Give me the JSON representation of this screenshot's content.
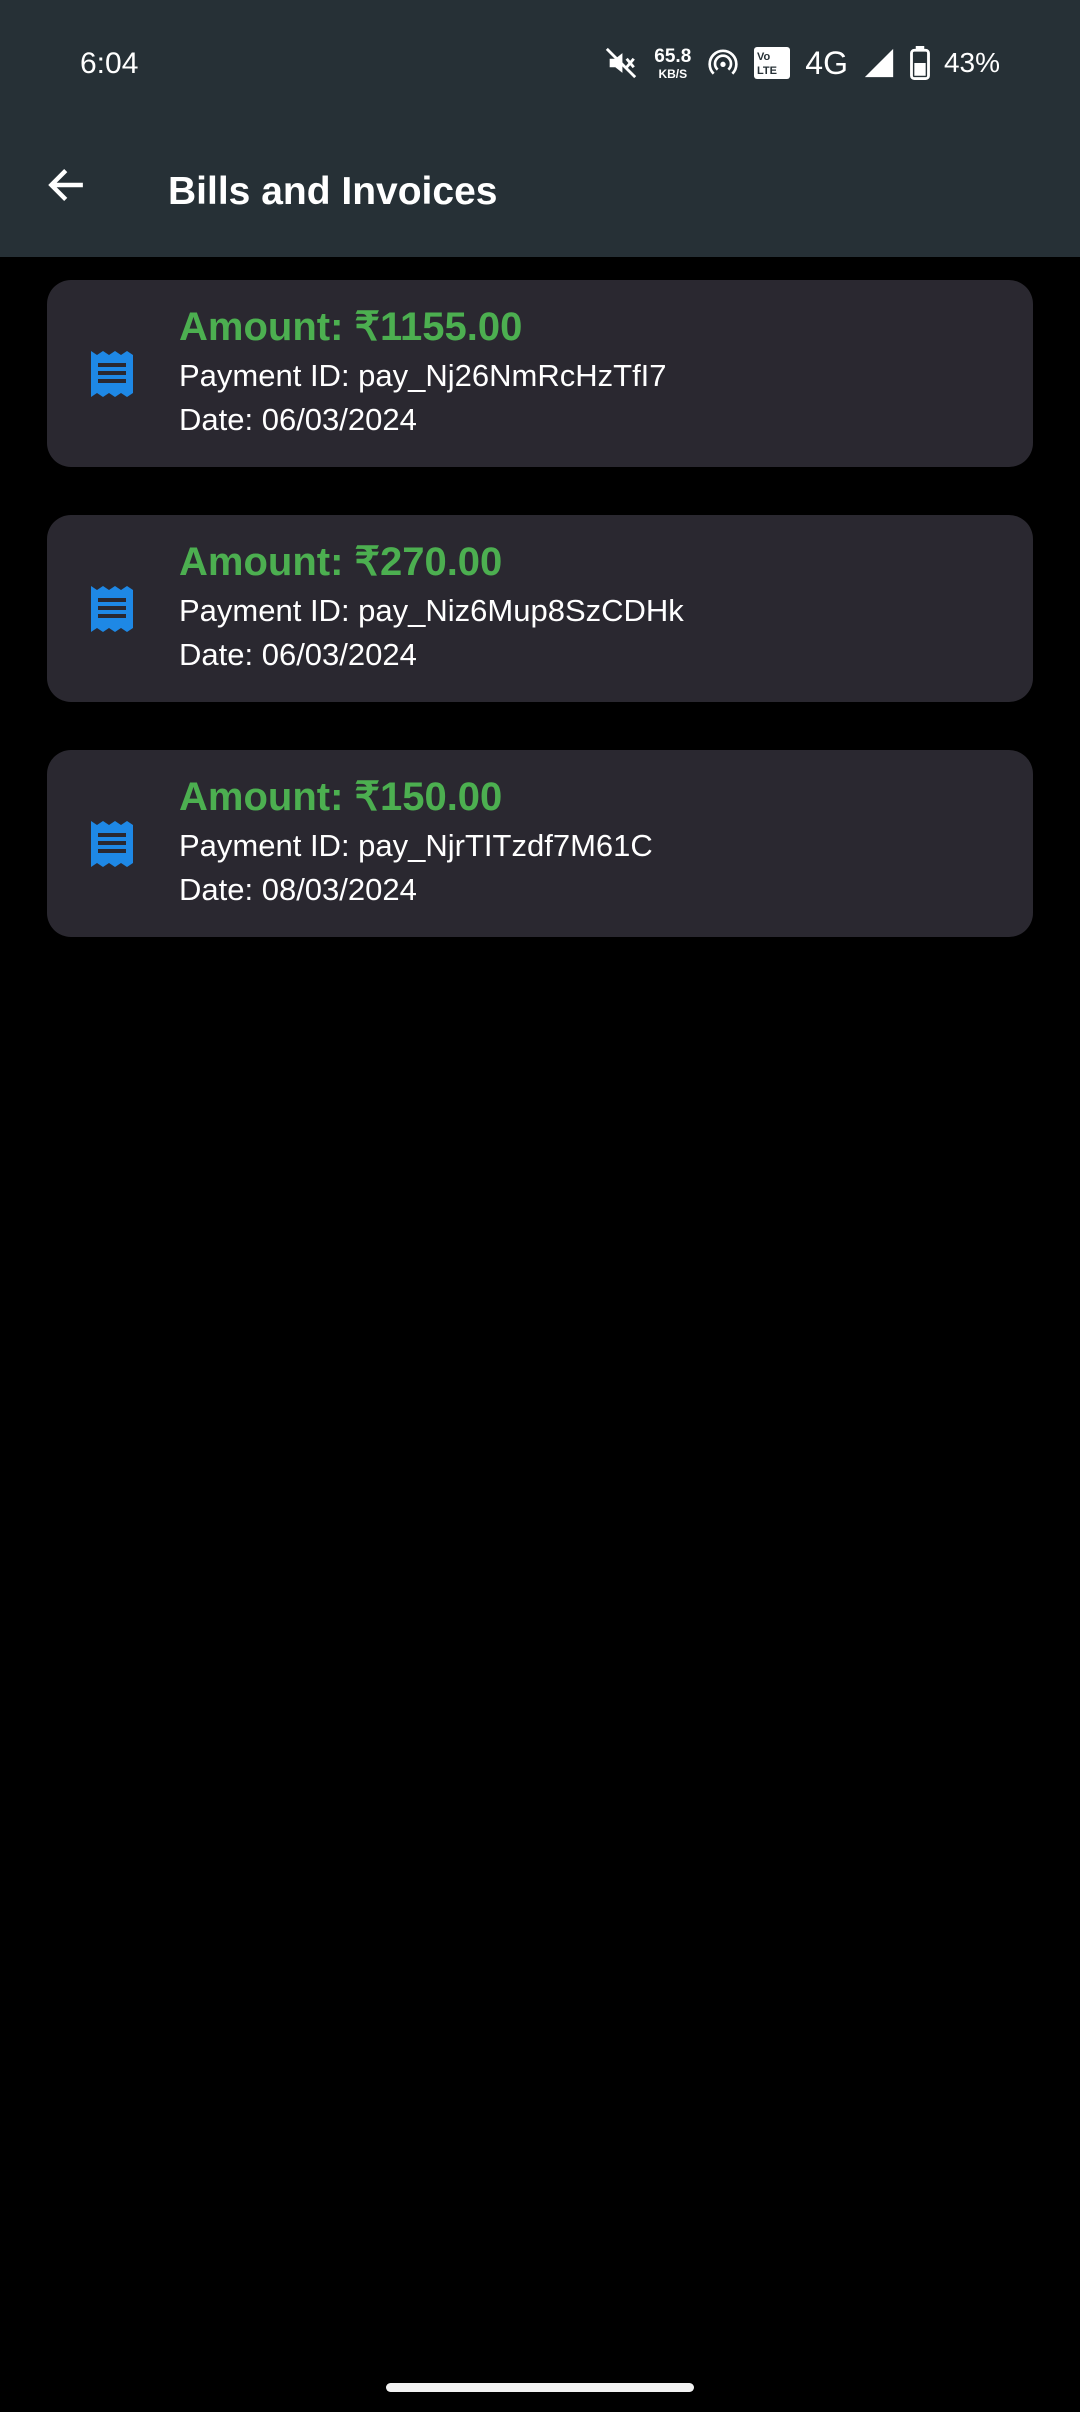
{
  "status_bar": {
    "time": "6:04",
    "net_speed_value": "65.8",
    "net_speed_unit": "KB/S",
    "volte_label_top": "Vo",
    "volte_label_bottom": "LTE",
    "network_type": "4G",
    "battery_percent": "43%",
    "icons": [
      "mute-icon",
      "hotspot-icon",
      "volte-icon",
      "signal-icon",
      "battery-icon"
    ]
  },
  "app_bar": {
    "back_icon": "arrow-back-icon",
    "title": "Bills and Invoices"
  },
  "colors": {
    "app_bar_bg": "#263036",
    "card_bg": "#2a2830",
    "amount_green": "#4caf50",
    "icon_blue": "#1e88e5",
    "background": "#000000"
  },
  "bills": [
    {
      "icon": "receipt-icon",
      "amount": "Amount: ₹1155.00",
      "payment_id": "Payment ID: pay_Nj26NmRcHzTfI7",
      "date": "Date: 06/03/2024"
    },
    {
      "icon": "receipt-icon",
      "amount": "Amount: ₹270.00",
      "payment_id": "Payment ID: pay_Niz6Mup8SzCDHk",
      "date": "Date: 06/03/2024"
    },
    {
      "icon": "receipt-icon",
      "amount": "Amount: ₹150.00",
      "payment_id": "Payment ID: pay_NjrTITzdf7M61C",
      "date": "Date: 08/03/2024"
    }
  ]
}
